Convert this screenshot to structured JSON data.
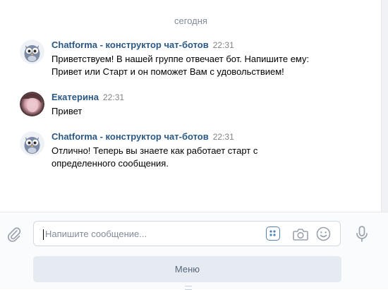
{
  "chat": {
    "date_divider": "сегодня",
    "messages": [
      {
        "author": "Chatforma - конструктор чат-ботов",
        "time": "22:31",
        "line1": "Приветствуем! В нашей группе отвечает бот. Напишите ему:",
        "line2": "Привет или Старт и он поможет Вам с удовольствием!"
      },
      {
        "author": "Екатерина",
        "time": "22:31",
        "line1": "Привет"
      },
      {
        "author": "Chatforma - конструктор чат-ботов",
        "time": "22:31",
        "line1": "Отлично! Теперь вы знаете как работает старт с",
        "line2": "определенного сообщения."
      }
    ]
  },
  "composer": {
    "placeholder": "Напишите сообщение...",
    "menu_label": "Меню"
  },
  "icons": {
    "attach": "paperclip-icon",
    "keyboard": "bot-keyboard-icon",
    "camera": "camera-icon",
    "emoji": "smile-icon",
    "voice": "microphone-icon"
  },
  "colors": {
    "accent": "#5181b8",
    "author": "#2a5885",
    "muted": "#828282",
    "menu_bg": "#e5ebf1"
  }
}
